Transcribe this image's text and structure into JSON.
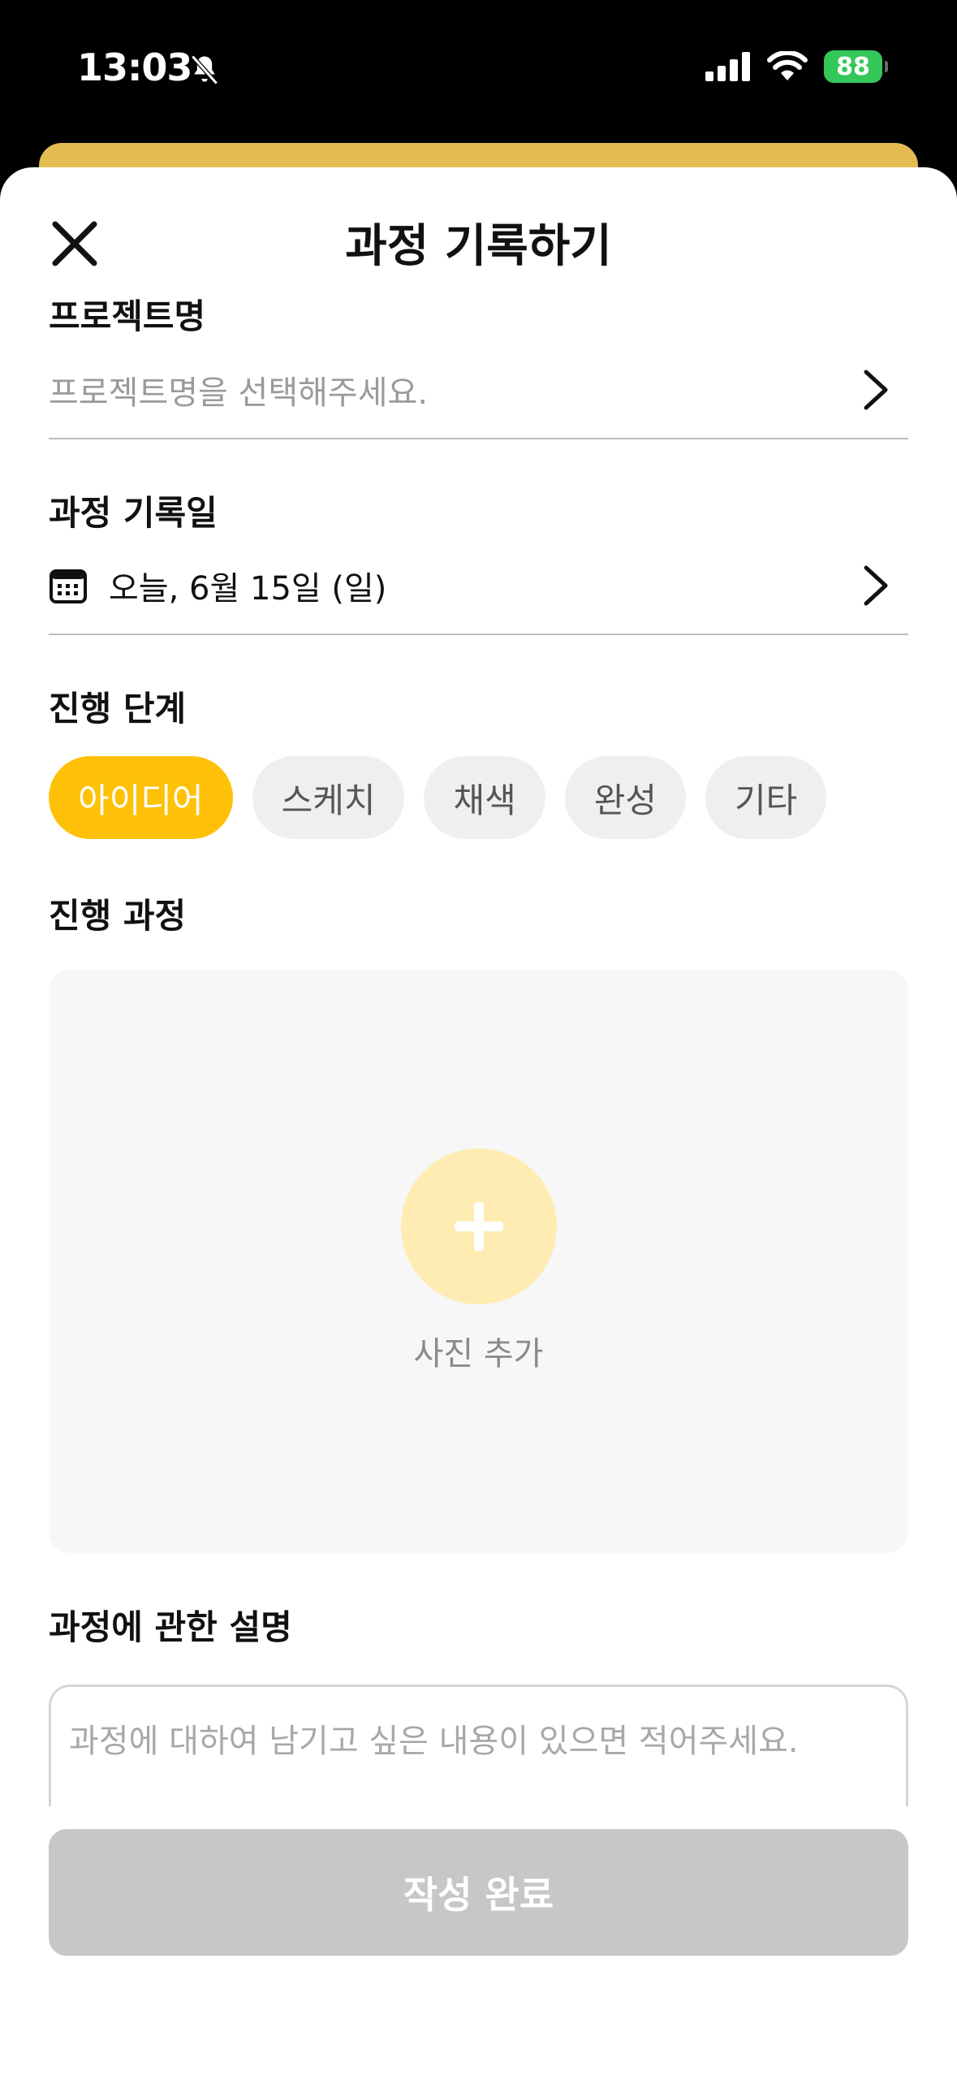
{
  "status_bar": {
    "time": "13:03",
    "battery": "88"
  },
  "header": {
    "title": "과정 기록하기"
  },
  "project": {
    "label": "프로젝트명",
    "placeholder": "프로젝트명을 선택해주세요."
  },
  "record_date": {
    "label": "과정 기록일",
    "value": "오늘, 6월 15일 (일)"
  },
  "stage": {
    "label": "진행 단계",
    "options": [
      "아이디어",
      "스케치",
      "채색",
      "완성",
      "기타"
    ],
    "selected": "아이디어"
  },
  "progress": {
    "label": "진행 과정",
    "add_photo_label": "사진 추가"
  },
  "description": {
    "label": "과정에 관한 설명",
    "placeholder": "과정에 대하여 남기고 싶은 내용이 있으면 적어주세요."
  },
  "submit": {
    "label": "작성 완료"
  },
  "colors": {
    "accent": "#ffc107",
    "accent_light": "#ffecb3",
    "disabled_button": "#c7c7c9",
    "back_sheet": "#e3bd51"
  }
}
